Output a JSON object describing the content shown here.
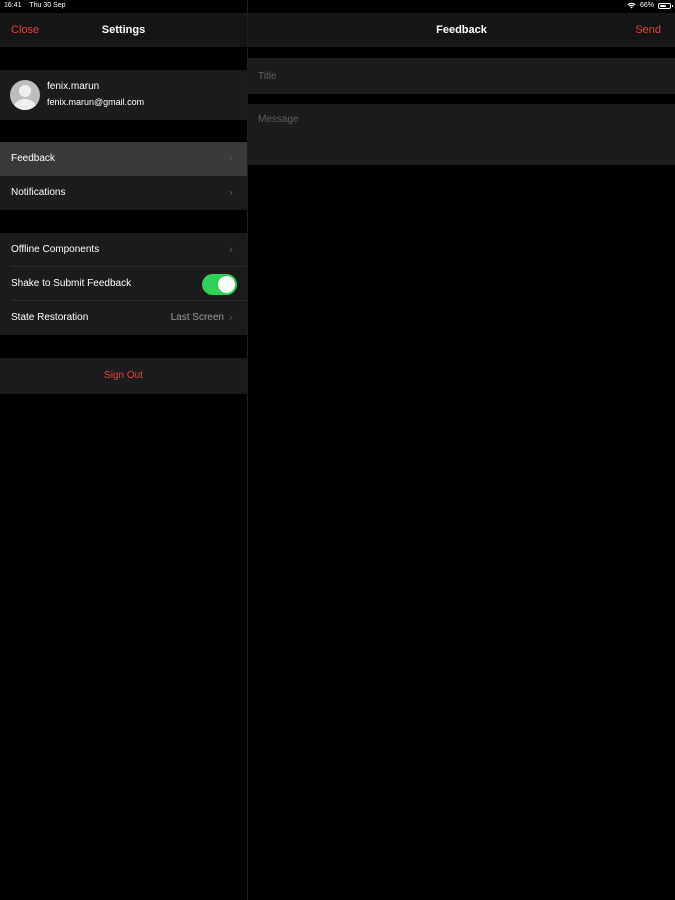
{
  "status_bar": {
    "time": "16:41",
    "date": "Thu 30 Sep",
    "battery": "66%",
    "battery_level": 0.66
  },
  "settings": {
    "title": "Settings",
    "close_label": "Close",
    "profile": {
      "name": "fenix.marun",
      "email": "fenix.marun@gmail.com"
    },
    "rows": {
      "feedback": "Feedback",
      "notifications": "Notifications",
      "offline_components": "Offline Components",
      "shake_to_submit": "Shake to Submit Feedback",
      "shake_to_submit_on": true,
      "state_restoration": "State Restoration",
      "state_restoration_value": "Last Screen"
    },
    "sign_out_label": "Sign Out",
    "chevron": "›"
  },
  "feedback": {
    "title": "Feedback",
    "send_label": "Send",
    "title_placeholder": "Title",
    "message_placeholder": "Message"
  },
  "colors": {
    "accent": "#e0453c",
    "toggle_on": "#30d158",
    "cell_bg": "#1c1c1e",
    "selected_bg": "#3a3a3c"
  }
}
